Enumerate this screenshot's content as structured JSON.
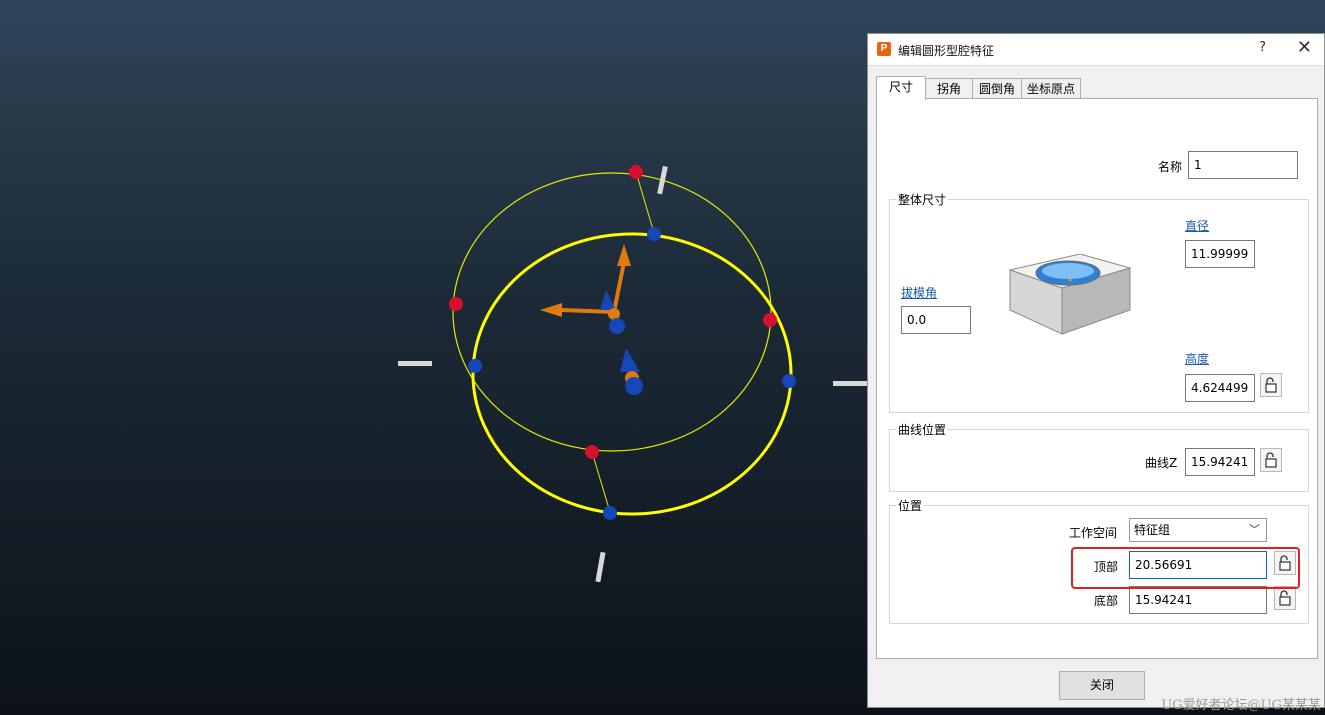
{
  "dialog": {
    "title": "编辑圆形型腔特征",
    "app_icon": "P",
    "help": "?",
    "close": "✕",
    "tabs": [
      "尺寸",
      "拐角",
      "圆倒角",
      "坐标原点"
    ],
    "active_tab": "尺寸",
    "name_label": "名称",
    "name_value": "1",
    "overall": {
      "title": "整体尺寸",
      "diameter_label": "直径",
      "diameter_value": "11.99999",
      "draft_label": "拔模角",
      "draft_value": "0.0",
      "height_label": "高度",
      "height_value": "4.624499"
    },
    "curve": {
      "title": "曲线位置",
      "z_label": "曲线Z",
      "z_value": "15.94241"
    },
    "position": {
      "title": "位置",
      "workspace_label": "工作空间",
      "workspace_value": "特征组",
      "top_label": "顶部",
      "top_value": "20.56691",
      "bottom_label": "底部",
      "bottom_value": "15.94241"
    },
    "close_button": "关闭"
  },
  "colors": {
    "highlight": "#e02020",
    "circle": "#ffff00",
    "handle_red": "#d81030",
    "handle_blue": "#1447b8",
    "axis_orange": "#e07a10"
  },
  "watermark": "UG爱好者论坛@UG某某某"
}
